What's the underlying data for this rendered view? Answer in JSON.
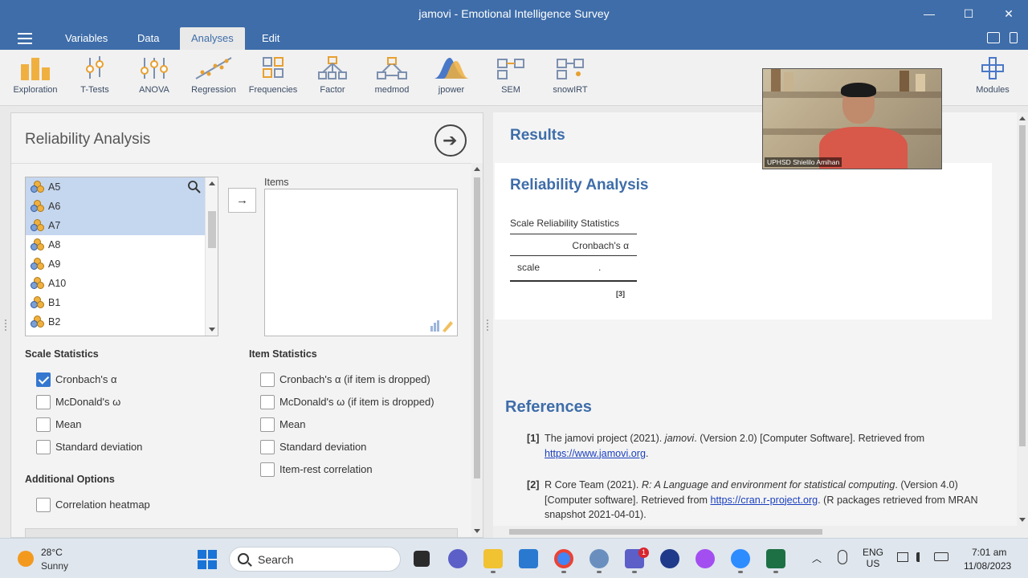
{
  "window": {
    "title": "jamovi - Emotional Intelligence Survey",
    "controls": {
      "minimize": "—",
      "maximize": "☐",
      "close": "✕"
    }
  },
  "menu": {
    "tabs": [
      "Variables",
      "Data",
      "Analyses",
      "Edit"
    ],
    "active_tab": "Analyses"
  },
  "ribbon": {
    "items": [
      {
        "label": "Exploration",
        "icon": "exploration-icon"
      },
      {
        "label": "T-Tests",
        "icon": "t-tests-icon"
      },
      {
        "label": "ANOVA",
        "icon": "anova-icon"
      },
      {
        "label": "Regression",
        "icon": "regression-icon"
      },
      {
        "label": "Frequencies",
        "icon": "frequencies-icon"
      },
      {
        "label": "Factor",
        "icon": "factor-icon"
      },
      {
        "label": "medmod",
        "icon": "medmod-icon"
      },
      {
        "label": "jpower",
        "icon": "jpower-icon"
      },
      {
        "label": "SEM",
        "icon": "sem-icon"
      },
      {
        "label": "snowIRT",
        "icon": "snowirt-icon"
      }
    ],
    "modules_label": "Modules"
  },
  "analysis": {
    "title": "Reliability Analysis",
    "variables": [
      {
        "name": "A5",
        "selected": true
      },
      {
        "name": "A6",
        "selected": true
      },
      {
        "name": "A7",
        "selected": true
      },
      {
        "name": "A8",
        "selected": false
      },
      {
        "name": "A9",
        "selected": false
      },
      {
        "name": "A10",
        "selected": false
      },
      {
        "name": "B1",
        "selected": false
      },
      {
        "name": "B2",
        "selected": false
      }
    ],
    "move_arrow": "→",
    "items_label": "Items",
    "scale_statistics": {
      "heading": "Scale Statistics",
      "options": [
        {
          "label": "Cronbach's α",
          "checked": true
        },
        {
          "label": "McDonald's ω",
          "checked": false
        },
        {
          "label": "Mean",
          "checked": false
        },
        {
          "label": "Standard deviation",
          "checked": false
        }
      ]
    },
    "item_statistics": {
      "heading": "Item Statistics",
      "options": [
        {
          "label": "Cronbach's α (if item is dropped)",
          "checked": false
        },
        {
          "label": "McDonald's ω (if item is dropped)",
          "checked": false
        },
        {
          "label": "Mean",
          "checked": false
        },
        {
          "label": "Standard deviation",
          "checked": false
        },
        {
          "label": "Item-rest correlation",
          "checked": false
        }
      ]
    },
    "additional_options": {
      "heading": "Additional Options",
      "options": [
        {
          "label": "Correlation heatmap",
          "checked": false
        }
      ]
    }
  },
  "results": {
    "title": "Results",
    "analysis_title": "Reliability Analysis",
    "table": {
      "caption": "Scale Reliability Statistics",
      "column": "Cronbach's α",
      "row_name": "scale",
      "row_value": ".",
      "note": "[3]"
    },
    "references_title": "References",
    "references": [
      {
        "num": "[1]",
        "pre": "The jamovi project (2021). ",
        "italic": "jamovi",
        "post": ". (Version 2.0) [Computer Software]. Retrieved from ",
        "link": "https://www.jamovi.org",
        "after": "."
      },
      {
        "num": "[2]",
        "pre": "R Core Team (2021). ",
        "italic": "R: A Language and environment for statistical computing",
        "post": ". (Version 4.0) [Computer software]. Retrieved from ",
        "link": "https://cran.r-project.org",
        "after": ". (R packages retrieved from MRAN snapshot 2021-04-01)."
      }
    ]
  },
  "video": {
    "participant": "UPHSD Shielilo Amihan"
  },
  "taskbar": {
    "weather_temp": "28°C",
    "weather_desc": "Sunny",
    "search_label": "Search",
    "teams_badge": "1",
    "language_line1": "ENG",
    "language_line2": "US",
    "time": "7:01 am",
    "date": "11/08/2023",
    "colors": {
      "start": "#1a73d6",
      "teams": "#5b5fc7",
      "excel": "#1d7044",
      "chrome": "#4285f4"
    }
  }
}
